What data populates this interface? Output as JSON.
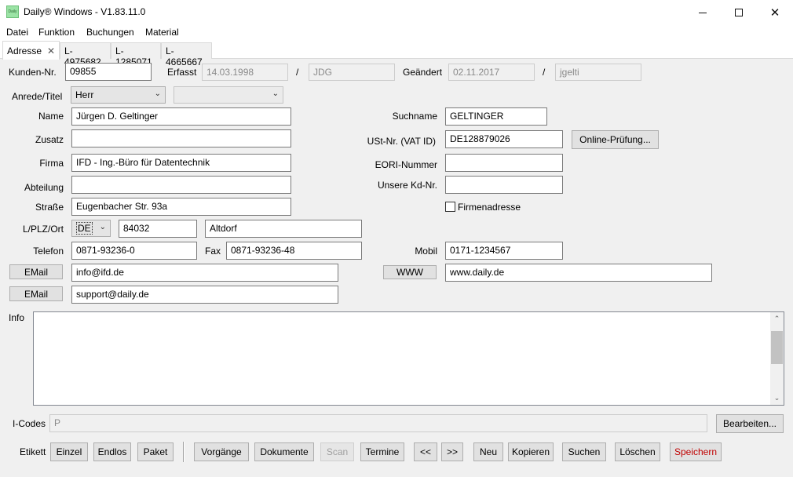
{
  "window": {
    "title": "Daily® Windows - V1.83.11.0",
    "icon": "Daily"
  },
  "menu": [
    "Datei",
    "Funktion",
    "Buchungen",
    "Material"
  ],
  "tabs": [
    {
      "label": "Adresse",
      "active": true
    },
    {
      "label": "L-4975682"
    },
    {
      "label": "L-1285071"
    },
    {
      "label": "L-4665667"
    }
  ],
  "form": {
    "kundennr": {
      "label": "Kunden-Nr.",
      "value": "09855"
    },
    "erfasst": {
      "label": "Erfasst",
      "date": "14.03.1998",
      "sep": "/",
      "user": "JDG"
    },
    "geaendert": {
      "label": "Geändert",
      "date": "02.11.2017",
      "sep": "/",
      "user": "jgelti"
    },
    "anrede": {
      "label": "Anrede/Titel",
      "value": "Herr",
      "titel": ""
    },
    "name": {
      "label": "Name",
      "value": "Jürgen D. Geltinger"
    },
    "zusatz": {
      "label": "Zusatz",
      "value": ""
    },
    "firma": {
      "label": "Firma",
      "value": "IFD - Ing.-Büro für Datentechnik"
    },
    "abteilung": {
      "label": "Abteilung",
      "value": ""
    },
    "strasse": {
      "label": "Straße",
      "value": "Eugenbacher Str. 93a"
    },
    "lplzort": {
      "label": "L/PLZ/Ort",
      "land": "DE",
      "plz": "84032",
      "ort": "Altdorf"
    },
    "telefon": {
      "label": "Telefon",
      "value": "0871-93236-0"
    },
    "fax": {
      "label": "Fax",
      "value": "0871-93236-48"
    },
    "email1": {
      "button": "EMail",
      "value": "info@ifd.de"
    },
    "email2": {
      "button": "EMail",
      "value": "support@daily.de"
    },
    "suchname": {
      "label": "Suchname",
      "value": "GELTINGER"
    },
    "ustnr": {
      "label": "USt-Nr. (VAT ID)",
      "value": "DE128879026",
      "button": "Online-Prüfung..."
    },
    "eori": {
      "label": "EORI-Nummer",
      "value": ""
    },
    "unserekdnr": {
      "label": "Unsere Kd-Nr.",
      "value": ""
    },
    "firmenadresse": {
      "label": "Firmenadresse",
      "checked": false
    },
    "mobil": {
      "label": "Mobil",
      "value": "0171-1234567"
    },
    "www": {
      "button": "WWW",
      "value": "www.daily.de"
    },
    "info": {
      "label": "Info",
      "value": ""
    },
    "icodes": {
      "label": "I-Codes",
      "value": "P",
      "button": "Bearbeiten..."
    }
  },
  "bottom": {
    "etikett_label": "Etikett",
    "einzel": "Einzel",
    "endlos": "Endlos",
    "paket": "Paket",
    "vorgaenge": "Vorgänge",
    "dokumente": "Dokumente",
    "scan": "Scan",
    "termine": "Termine",
    "prev": "<<",
    "next": ">>",
    "neu": "Neu",
    "kopieren": "Kopieren",
    "suchen": "Suchen",
    "loeschen": "Löschen",
    "speichern": "Speichern"
  },
  "colors": {
    "save_text": "#c00000",
    "window_bg": "#f0f0f0"
  }
}
